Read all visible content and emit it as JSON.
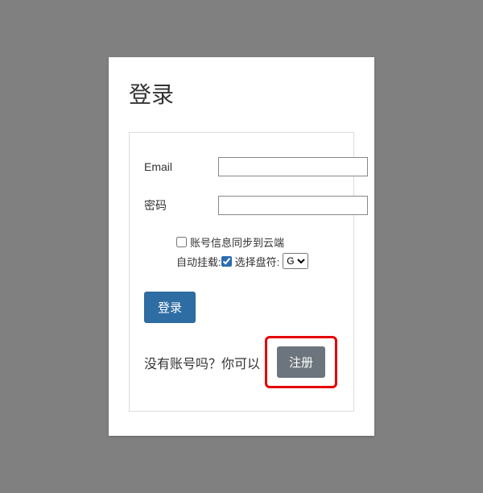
{
  "title": "登录",
  "form": {
    "email_label": "Email",
    "email_value": "",
    "password_label": "密码",
    "password_value": ""
  },
  "options": {
    "sync_cloud_label": "账号信息同步到云端",
    "sync_cloud_checked": false,
    "auto_mount_label": "自动挂载:",
    "select_drive_label": "选择盘符:",
    "select_drive_checked": true,
    "drive_selected": "G"
  },
  "buttons": {
    "login_label": "登录",
    "register_label": "注册"
  },
  "register_prompt": "没有账号吗？你可以"
}
